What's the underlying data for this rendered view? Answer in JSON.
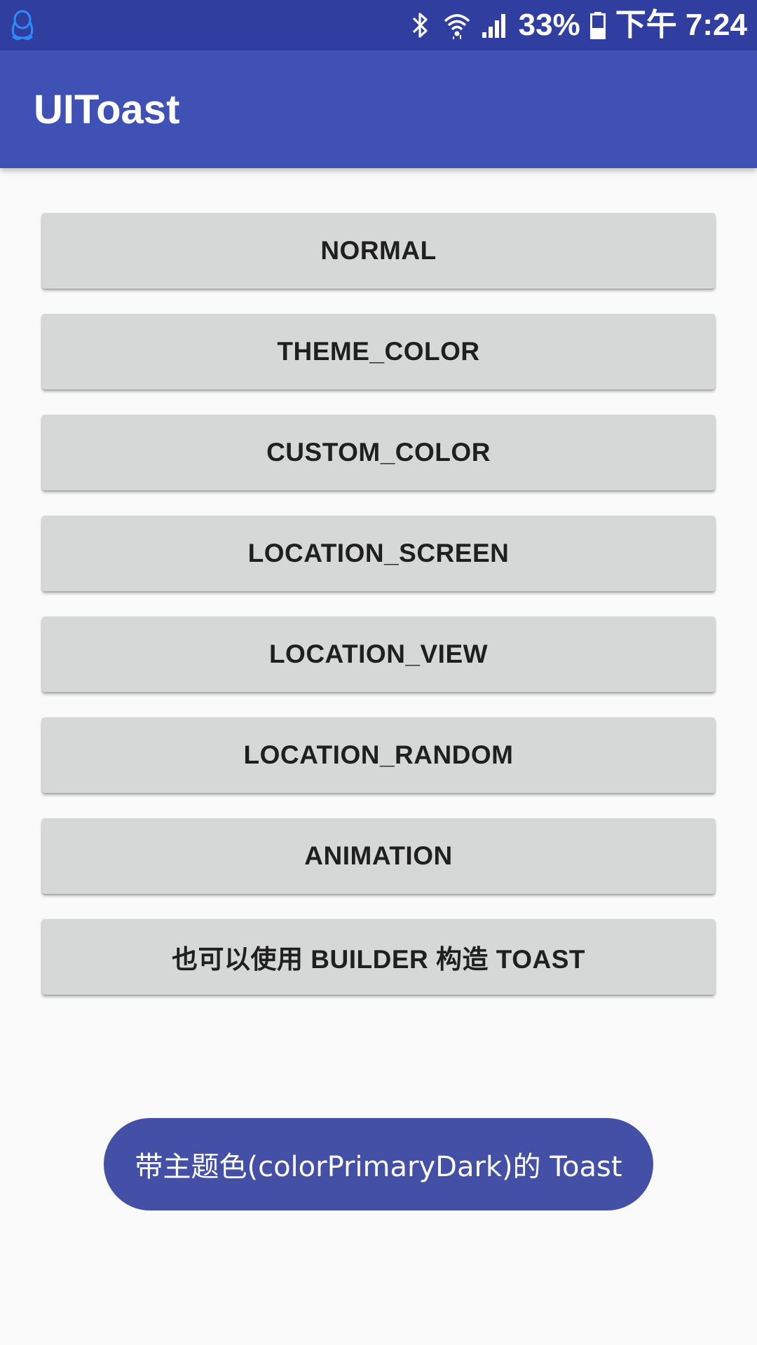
{
  "status_bar": {
    "left_icon": "qq-penguin-icon",
    "icons": [
      "bluetooth-icon",
      "wifi-icon",
      "signal-icon",
      "battery-icon"
    ],
    "battery_percent": "33%",
    "time": "下午 7:24"
  },
  "app_bar": {
    "title": "UIToast"
  },
  "buttons": [
    {
      "label": "NORMAL"
    },
    {
      "label": "THEME_COLOR"
    },
    {
      "label": "CUSTOM_COLOR"
    },
    {
      "label": "LOCATION_SCREEN"
    },
    {
      "label": "LOCATION_VIEW"
    },
    {
      "label": "LOCATION_RANDOM"
    },
    {
      "label": "ANIMATION"
    },
    {
      "label": "也可以使用 BUILDER 构造 TOAST"
    }
  ],
  "toast": {
    "text": "带主题色(colorPrimaryDark)的 Toast"
  },
  "colors": {
    "status_bar": "#303F9F",
    "app_bar": "#3F51B5",
    "background": "#FAFAFA",
    "button": "#D6D7D7",
    "toast": "#4350A6"
  }
}
